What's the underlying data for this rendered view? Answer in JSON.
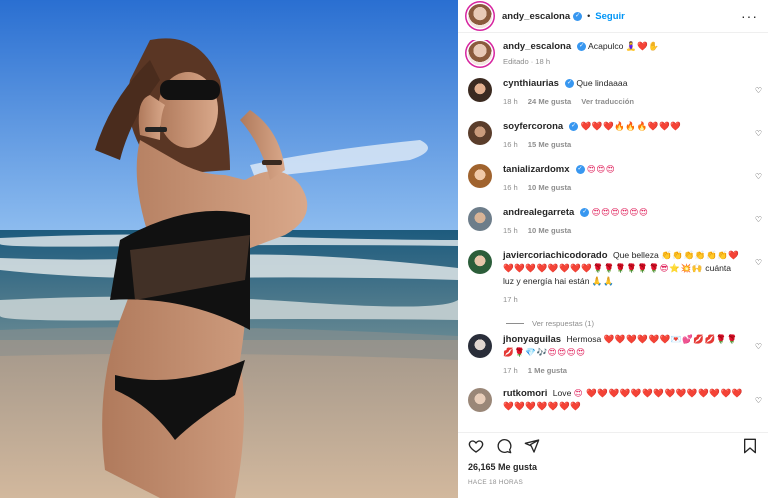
{
  "colors": {
    "accent": "#0095f6",
    "verified": "#3897f0",
    "heart": "#e0245e",
    "muted": "#8e8e8e"
  },
  "header": {
    "username": "andy_escalona",
    "separator": "•",
    "follow_label": "Seguir",
    "more_icon": "more-horizontal-icon",
    "more_label": "···"
  },
  "caption": {
    "username": "andy_escalona",
    "text": "Acapulco",
    "emoji": "🧘‍♀️❤️✋",
    "edited_label": "Editado",
    "dot": "·",
    "time": "18 h"
  },
  "comments": [
    {
      "username": "cynthiaurias",
      "verified": true,
      "text": "Que lindaaaa",
      "emoji": "",
      "time": "18 h",
      "likes": "24 Me gusta",
      "reply_label": "Ver traducción"
    },
    {
      "username": "soyfercorona",
      "verified": true,
      "text": "",
      "emoji": "❤️❤️❤️🔥🔥🔥❤️❤️❤️",
      "time": "16 h",
      "likes": "15 Me gusta",
      "reply_label": ""
    },
    {
      "username": "tanializardomx",
      "verified": true,
      "text": "",
      "emoji": "😍😍😍",
      "time": "16 h",
      "likes": "10 Me gusta",
      "reply_label": ""
    },
    {
      "username": "andrealegarreta",
      "verified": true,
      "text": "",
      "emoji": "😍😍😍😍😍😍",
      "time": "15 h",
      "likes": "10 Me gusta",
      "reply_label": ""
    },
    {
      "username": "javiercoriachicodorado",
      "verified": false,
      "text": "Que belleza",
      "emoji": "👏👏👏👏👏👏❤️❤️❤️❤️❤️❤️❤️❤️❤️🌹🌹🌹🌹🌹🌹😎⭐💥🙌",
      "text2": "cuánta luz y energía hai están",
      "emoji2": "🙏🙏",
      "time": "17 h",
      "likes": "",
      "reply_label": ""
    },
    {
      "username": "jhonyaguilas",
      "verified": false,
      "text": "Hermosa",
      "emoji": "❤️❤️❤️❤️❤️❤️💌💕💋💋🌹🌹💋🌹💎🎶😍😍😍😍",
      "time": "17 h",
      "likes": "1 Me gusta",
      "reply_label": ""
    },
    {
      "username": "rutkomori",
      "verified": false,
      "text": "Love",
      "emoji": "😍 ❤️❤️❤️❤️❤️❤️❤️❤️❤️❤️❤️❤️❤️❤️❤️❤️❤️❤️❤️❤️❤️",
      "time": "",
      "likes": "",
      "reply_label": ""
    }
  ],
  "view_replies": "Ver respuestas (1)",
  "actions": {
    "like_icon": "heart-icon",
    "comment_icon": "comment-icon",
    "share_icon": "share-icon",
    "save_icon": "bookmark-icon"
  },
  "likes_count": "26,165 Me gusta",
  "posted_ago": "HACE 18 HORAS"
}
